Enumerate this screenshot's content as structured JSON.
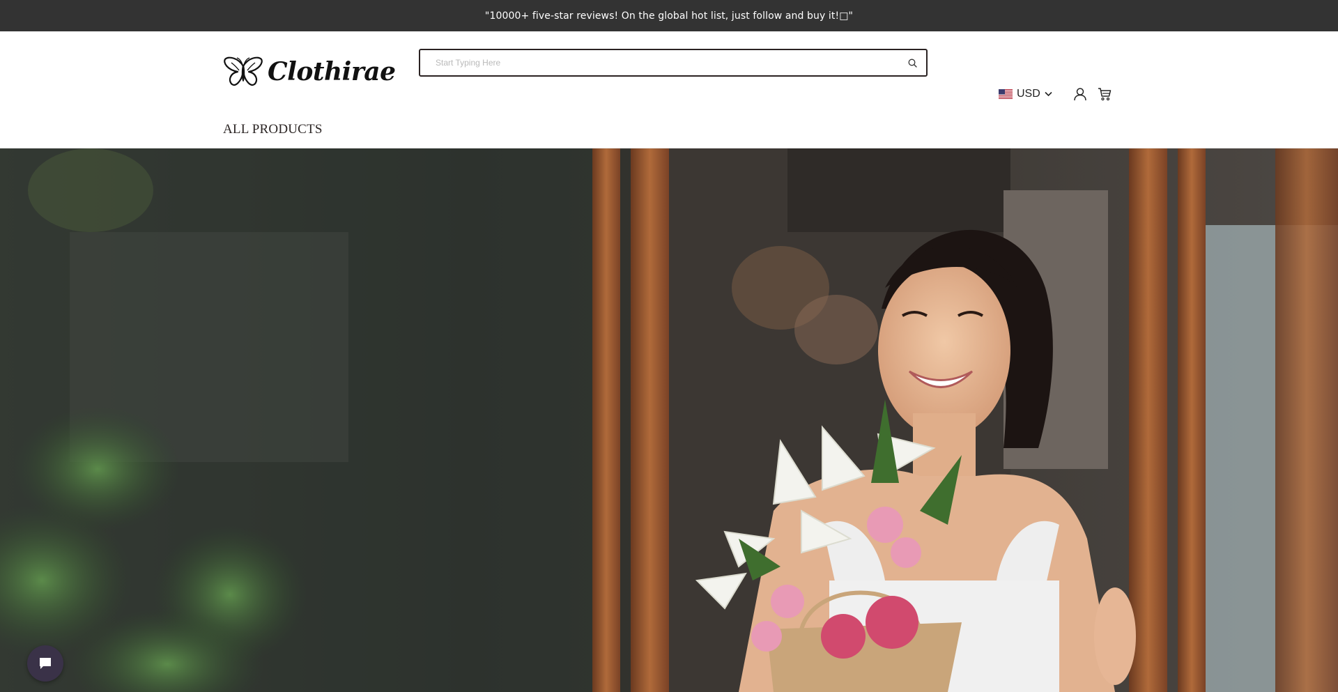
{
  "announcement": {
    "text": "\"10000+ five-star reviews! On the global hot list, just follow and buy it!□\""
  },
  "header": {
    "logo_text": "Clothirae",
    "search": {
      "placeholder": "Start Typing Here",
      "value": "",
      "icon": "search-icon"
    },
    "currency": {
      "code": "USD",
      "flag": "us-flag-icon",
      "chevron": "chevron-down-icon"
    },
    "account_icon": "user-icon",
    "cart_icon": "cart-icon"
  },
  "nav": {
    "items": [
      {
        "label": "ALL PRODUCTS"
      }
    ]
  },
  "hero": {
    "image": "photo-woman-with-flower-bouquet"
  },
  "chat": {
    "icon": "chat-bubble-icon"
  },
  "colors": {
    "announcement_bg": "#333333",
    "chat_button_bg": "#3a3248",
    "search_border": "#2a2222"
  }
}
